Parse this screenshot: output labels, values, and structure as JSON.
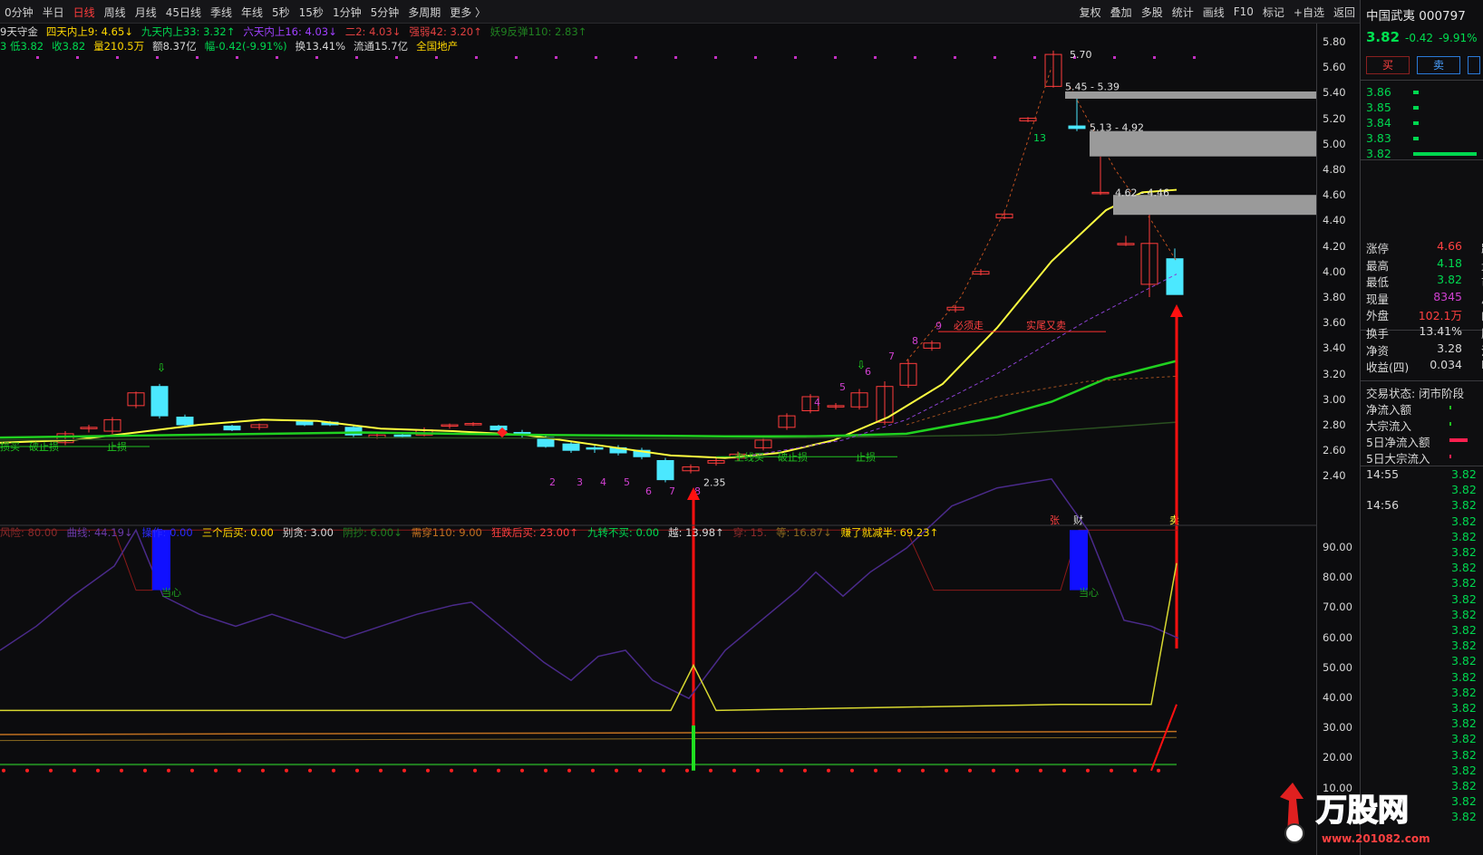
{
  "toolbar": {
    "periods": [
      "0分钟",
      "半日",
      "日线",
      "周线",
      "月线",
      "45日线",
      "季线",
      "年线",
      "5秒",
      "15秒",
      "1分钟",
      "5分钟",
      "多周期",
      "更多 〉"
    ],
    "active_period": "日线",
    "tools": [
      "复权",
      "叠加",
      "多股",
      "统计",
      "画线",
      "F10",
      "标记",
      "+自选",
      "返回"
    ]
  },
  "info_line1": [
    {
      "text": "9天守金",
      "color": "#d8d8d8"
    },
    {
      "text": "四天内上9: 4.65↓",
      "color": "#ffd700"
    },
    {
      "text": "九天内上33: 3.32↑",
      "color": "#00d850"
    },
    {
      "text": "六天内上16: 4.03↓",
      "color": "#a040ff"
    },
    {
      "text": "二2: 4.03↓",
      "color": "#e04040"
    },
    {
      "text": "强弱42: 3.20↑",
      "color": "#e04040"
    },
    {
      "text": "妖9反弹110: 2.83↑",
      "color": "#208020"
    }
  ],
  "info_line2": [
    {
      "text": "3 低3.82",
      "color": "#00d850"
    },
    {
      "text": "收3.82",
      "color": "#00d850"
    },
    {
      "text": "量210.5万",
      "color": "#ffd700"
    },
    {
      "text": "额8.37亿",
      "color": "#d8d8d8"
    },
    {
      "text": "幅-0.42(-9.91%)",
      "color": "#00d850"
    },
    {
      "text": "换13.41%",
      "color": "#d8d8d8"
    },
    {
      "text": "流通15.7亿",
      "color": "#d8d8d8"
    },
    {
      "text": "全国地产",
      "color": "#ffd700"
    }
  ],
  "indicator_header": [
    {
      "text": "风险: 80.00",
      "color": "#8a2a2a"
    },
    {
      "text": "曲线: 44.19↓",
      "color": "#6a3aa8"
    },
    {
      "text": "操作: 0.00",
      "color": "#2a2aff"
    },
    {
      "text": "三个后买: 0.00",
      "color": "#ffd700"
    },
    {
      "text": "别贪: 3.00",
      "color": "#d8d8d8"
    },
    {
      "text": "阴抄: 6.00↓",
      "color": "#208020"
    },
    {
      "text": "需穿110: 9.00",
      "color": "#c07020"
    },
    {
      "text": "狂跌后买: 23.00↑",
      "color": "#ff4040"
    },
    {
      "text": "九转不买: 0.00",
      "color": "#00d850"
    },
    {
      "text": "越: 13.98↑",
      "color": "#d8d8d8"
    },
    {
      "text": "穿: 15.",
      "color": "#8a2a2a"
    },
    {
      "text": "等: 16.87↓",
      "color": "#8a6a20"
    },
    {
      "text": "赚了就减半: 69.23↑",
      "color": "#ffd700"
    }
  ],
  "price_axis": [
    "5.80",
    "5.60",
    "5.40",
    "5.20",
    "5.00",
    "4.80",
    "4.60",
    "4.40",
    "4.20",
    "4.00",
    "3.80",
    "3.60",
    "3.40",
    "3.20",
    "3.00",
    "2.80",
    "2.60",
    "2.40"
  ],
  "ind_axis": [
    "90.00",
    "80.00",
    "70.00",
    "60.00",
    "50.00",
    "40.00",
    "30.00",
    "20.00",
    "10.00"
  ],
  "chart_labels": {
    "high": "5.70",
    "zone1": "5.45 - 5.39",
    "zone2": "5.13 - 4.92",
    "zone3": "4.62 - 4.46",
    "low": "2.35",
    "must_go": "必须走",
    "real_sell": "实尾又卖",
    "stop1": "止损",
    "stop2": "破止损",
    "stop3": "止损",
    "stop4": "主线买",
    "stop5": "破止损",
    "stop6": "止损",
    "seq13": "13",
    "careful1": "当心",
    "careful2": "当心",
    "zhang": "张",
    "cai": "财",
    "sell_mark": "卖"
  },
  "panel": {
    "title": "中国武夷 000797",
    "price": "3.82",
    "change": "-0.42",
    "pct": "-9.91%",
    "buy": "买",
    "sell": "卖",
    "bids": [
      "3.86",
      "3.85",
      "3.84",
      "3.83",
      "3.82"
    ],
    "stats": [
      {
        "k": "涨停",
        "v": "4.66",
        "c": "#ff4040",
        "s": "跌"
      },
      {
        "k": "最高",
        "v": "4.18",
        "c": "#00d850",
        "s": "量"
      },
      {
        "k": "最低",
        "v": "3.82",
        "c": "#00d850",
        "s": "市"
      },
      {
        "k": "现量",
        "v": "8345",
        "c": "#d040d0",
        "s": "总"
      },
      {
        "k": "外盘",
        "v": "102.1万",
        "c": "#ff4040",
        "s": "内"
      }
    ],
    "stats2": [
      {
        "k": "换手",
        "v": "13.41%",
        "c": "#d8d8d8",
        "s": "股"
      },
      {
        "k": "净资",
        "v": "3.28",
        "c": "#d8d8d8",
        "s": "流"
      },
      {
        "k": "收益(四)",
        "v": "0.034",
        "c": "#d8d8d8",
        "s": "P"
      }
    ],
    "trade_status": "交易状态: 闭市阶段",
    "flows": [
      "净流入额",
      "大宗流入",
      "5日净流入额",
      "5日大宗流入"
    ],
    "ticks": [
      {
        "t": "14:55",
        "p": "3.82"
      },
      {
        "t": "",
        "p": "3.82"
      },
      {
        "t": "14:56",
        "p": "3.82"
      },
      {
        "t": "",
        "p": "3.82"
      },
      {
        "t": "",
        "p": "3.82"
      },
      {
        "t": "",
        "p": "3.82"
      },
      {
        "t": "",
        "p": "3.82"
      },
      {
        "t": "",
        "p": "3.82"
      },
      {
        "t": "",
        "p": "3.82"
      },
      {
        "t": "",
        "p": "3.82"
      },
      {
        "t": "",
        "p": "3.82"
      },
      {
        "t": "",
        "p": "3.82"
      },
      {
        "t": "",
        "p": "3.82"
      },
      {
        "t": "",
        "p": "3.82"
      },
      {
        "t": "",
        "p": "3.82"
      },
      {
        "t": "",
        "p": "3.82"
      },
      {
        "t": "",
        "p": "3.82"
      },
      {
        "t": "",
        "p": "3.82"
      },
      {
        "t": "",
        "p": "3.82"
      },
      {
        "t": "",
        "p": "3.82"
      },
      {
        "t": "",
        "p": "3.82"
      },
      {
        "t": "",
        "p": "3.82"
      },
      {
        "t": "",
        "p": "3.82"
      }
    ]
  },
  "watermark": "万股网",
  "watermark_url": "www.201082.com",
  "colors": {
    "up": "#ff3c3c",
    "down": "#00d850",
    "cyan": "#4be8ff",
    "yellow": "#ffff40",
    "bg": "#0c0c0e"
  }
}
